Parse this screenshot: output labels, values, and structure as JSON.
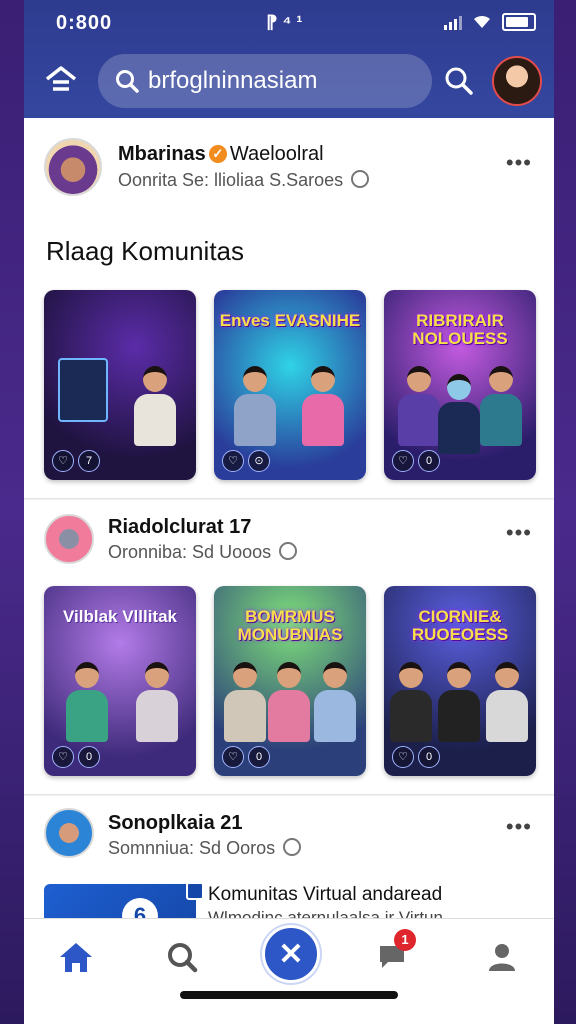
{
  "status_bar": {
    "time": "0:800",
    "center": "⁋ ⁴ ¹"
  },
  "search": {
    "text": "brfoglninnasiam"
  },
  "posts": [
    {
      "name": "Mbarinas",
      "name_rest": "Waeloolral",
      "sub": "Oonrita Se: llioliaa S.Saroes",
      "section_title": "Rlaag Komunitas",
      "tiles": [
        {
          "title": "",
          "badges": [
            "♡",
            "7"
          ],
          "theme": "dark"
        },
        {
          "title": "Enves EVASNIHE",
          "badges": [
            "♡",
            "⊙"
          ],
          "theme": "cyan"
        },
        {
          "title": "RIBRIRAIR NOLOUESS",
          "badges": [
            "♡",
            "0"
          ],
          "theme": "purple"
        }
      ]
    },
    {
      "name": "Riadolclurat 17",
      "sub": "Oronniba: Sd Uooos",
      "tiles": [
        {
          "title": "Vilblak Vlllitak",
          "badges": [
            "♡",
            "0"
          ],
          "theme": "violet"
        },
        {
          "title": "BOMRMUS MONUBNIAS",
          "badges": [
            "♡",
            "0"
          ],
          "theme": "green"
        },
        {
          "title": "CIORNIE& RUOEOESS",
          "badges": [
            "♡",
            "0"
          ],
          "theme": "blue"
        }
      ]
    },
    {
      "name": "Sonoplkaia 21",
      "sub": "Somnniua: Sd Ooros",
      "link_title": "Komunitas Virtual andaread",
      "link_sub": "Wlmodinc aternulaalsa ir Virtun",
      "link_thumb_num": "6"
    }
  ],
  "bottom_nav": {
    "notif_count": "1"
  },
  "colors": {
    "topbar": "#2e3b8f",
    "accent": "#2d57c7",
    "badge": "#e0262d"
  }
}
